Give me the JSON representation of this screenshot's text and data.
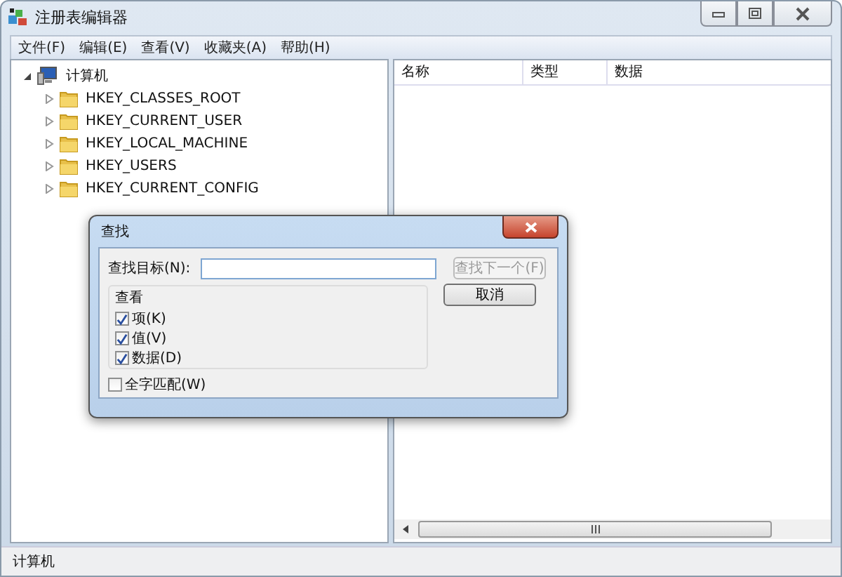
{
  "window": {
    "title": "注册表编辑器"
  },
  "menu": [
    "文件(F)",
    "编辑(E)",
    "查看(V)",
    "收藏夹(A)",
    "帮助(H)"
  ],
  "tree": {
    "label": "计算机",
    "expanded": true,
    "children": [
      {
        "label": "HKEY_CLASSES_ROOT",
        "expanded": false
      },
      {
        "label": "HKEY_CURRENT_USER",
        "expanded": false
      },
      {
        "label": "HKEY_LOCAL_MACHINE",
        "expanded": false
      },
      {
        "label": "HKEY_USERS",
        "expanded": false
      },
      {
        "label": "HKEY_CURRENT_CONFIG",
        "expanded": false
      }
    ]
  },
  "list": {
    "columns": [
      "名称",
      "类型",
      "数据"
    ]
  },
  "dialog": {
    "title": "查找",
    "target_label": "查找目标(N):",
    "find_next": {
      "label": "查找下一个(F)",
      "disabled": true
    },
    "cancel": "取消",
    "group_label": "查看",
    "options": [
      {
        "label": "项(K)",
        "checked": true
      },
      {
        "label": "值(V)",
        "checked": true
      },
      {
        "label": "数据(D)",
        "checked": true
      }
    ],
    "whole_word": {
      "label": "全字匹配(W)",
      "checked": false
    }
  },
  "status_bar": "计算机"
}
